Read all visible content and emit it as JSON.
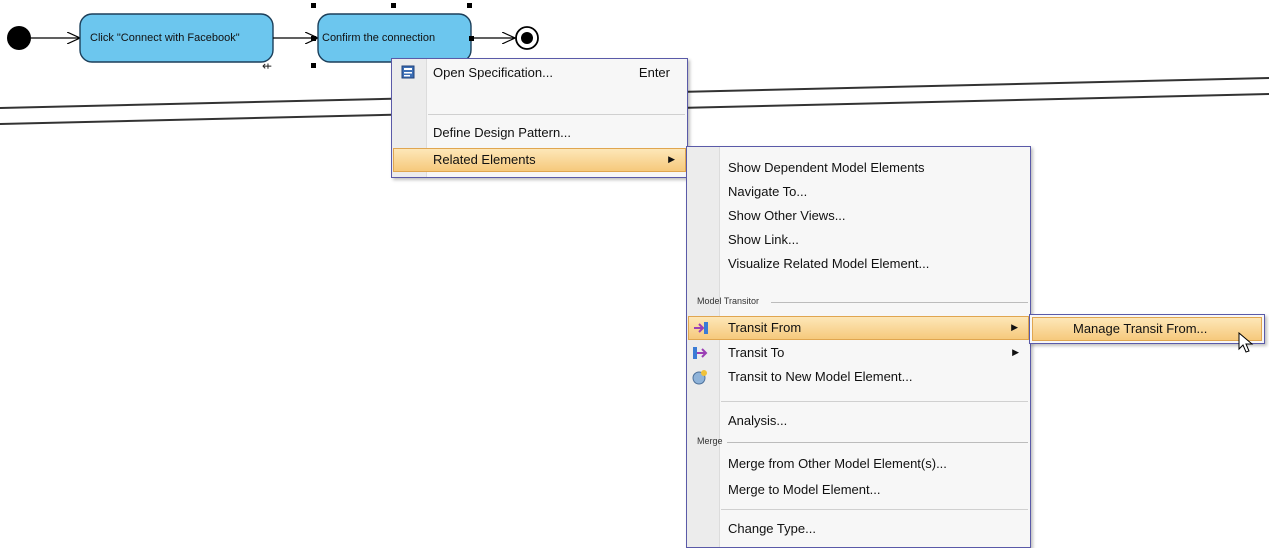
{
  "diagram": {
    "node1_label": "Click \"Connect with Facebook\"",
    "node2_label": "Confirm the connection"
  },
  "menu1": {
    "items": [
      {
        "label": "Open Specification...",
        "shortcut": "Enter",
        "icon": "specification-icon"
      },
      {
        "label": "Define Design Pattern..."
      },
      {
        "label": "Related Elements",
        "submenu": true,
        "highlighted": true
      }
    ]
  },
  "menu2": {
    "items": [
      {
        "label": "Show Dependent Model Elements"
      },
      {
        "label": "Navigate To..."
      },
      {
        "label": "Show Other Views..."
      },
      {
        "label": "Show Link..."
      },
      {
        "label": "Visualize Related Model Element..."
      },
      {
        "label": "Transit From",
        "submenu": true,
        "highlighted": true,
        "icon": "transit-from-icon"
      },
      {
        "label": "Transit To",
        "submenu": true,
        "icon": "transit-to-icon"
      },
      {
        "label": "Transit to New Model Element...",
        "icon": "new-model-element-icon"
      },
      {
        "label": "Analysis..."
      },
      {
        "label": "Merge from Other Model Element(s)..."
      },
      {
        "label": "Merge to Model Element..."
      },
      {
        "label": "Change Type..."
      }
    ],
    "groups": {
      "model_transitor": "Model Transitor",
      "merge": "Merge"
    }
  },
  "menu3": {
    "items": [
      {
        "label": "Manage Transit From...",
        "highlighted": true
      }
    ]
  },
  "colors": {
    "node_fill": "#6cc6ee",
    "menu_border": "#5a5aa8",
    "highlight": "#f6c97c"
  }
}
